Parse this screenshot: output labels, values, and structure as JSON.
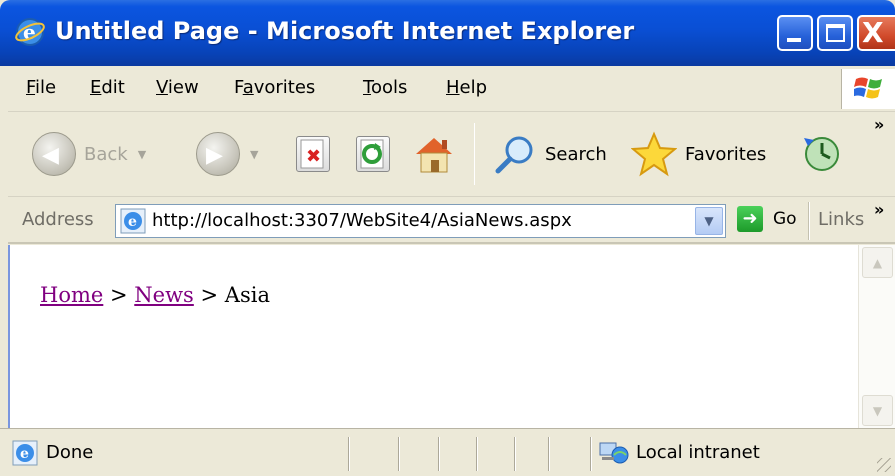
{
  "window": {
    "title": "Untitled Page - Microsoft Internet Explorer",
    "close_glyph": "X"
  },
  "menu": [
    "File",
    "Edit",
    "View",
    "Favorites",
    "Tools",
    "Help"
  ],
  "menu_mnemonics": [
    "F",
    "E",
    "V",
    "a",
    "T",
    "H"
  ],
  "toolbar": {
    "back_label": "Back",
    "search_label": "Search",
    "favorites_label": "Favorites",
    "overflow": "»"
  },
  "address": {
    "label": "Address",
    "url": "http://localhost:3307/WebSite4/AsiaNews.aspx",
    "go_label": "Go",
    "links_label": "Links",
    "overflow": "»"
  },
  "content": {
    "breadcrumb": {
      "home": "Home",
      "sep1": " > ",
      "news": "News",
      "sep2": " > ",
      "current": "Asia"
    }
  },
  "status": {
    "text": "Done",
    "zone": "Local intranet"
  },
  "colors": {
    "titlebar": "#0a4fd4",
    "link_visited": "#800080",
    "chrome": "#ece9d8"
  }
}
